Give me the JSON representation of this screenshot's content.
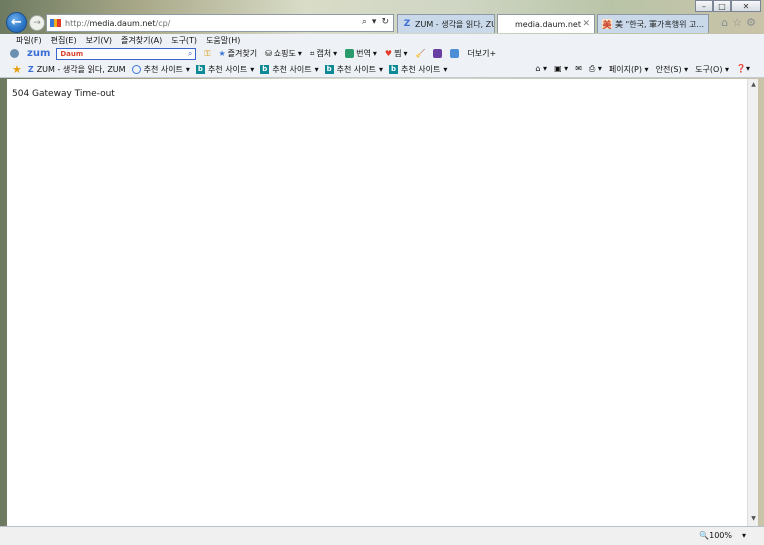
{
  "colors": {
    "accent": "#2f78c9",
    "favicon_blue": "#3a78d8",
    "favicon_yellow": "#f2b01e",
    "favicon_red": "#e23b2c",
    "zum_blue": "#3b6fd6",
    "daum_red": "#d8442f"
  },
  "window": {
    "controls": [
      "–",
      "□",
      "✕"
    ]
  },
  "nav": {
    "back_icon": "back-arrow-icon",
    "forward_icon": "forward-arrow-icon",
    "url_prefix": "http://",
    "url_domain": "media.daum.net",
    "url_path": "/cp/",
    "search_icon": "⌕",
    "dropdown_icon": "▾",
    "refresh_icon": "↻"
  },
  "tabs": [
    {
      "label": "ZUM - 생각을 읽다, ZU...",
      "icon": "Z",
      "active": false
    },
    {
      "label": "media.daum.net",
      "icon": "",
      "active": true,
      "close": "✕"
    },
    {
      "label": "美 \"한국, 軍가혹행위 고...",
      "icon": "美",
      "active": false
    }
  ],
  "right_icons": [
    "⌂",
    "☆",
    "⚙"
  ],
  "menu": [
    "파일(F)",
    "편집(E)",
    "보기(V)",
    "즐겨찾기(A)",
    "도구(T)",
    "도움말(H)"
  ],
  "zumbar": {
    "logo": "zum",
    "search_brand": "Daum",
    "search_placeholder": "",
    "items": [
      {
        "label": "즐겨찾기"
      },
      {
        "label": "쇼핑도"
      },
      {
        "label": "캡처"
      },
      {
        "label": "번역"
      },
      {
        "label": "찜"
      },
      {
        "label": "더보기+"
      }
    ]
  },
  "favorites": {
    "items": [
      {
        "label": "ZUM - 생각을 읽다, ZUM"
      },
      {
        "label": "추천 사이트"
      },
      {
        "label": "추천 사이트"
      },
      {
        "label": "추천 사이트"
      },
      {
        "label": "추천 사이트"
      },
      {
        "label": "추천 사이트"
      }
    ],
    "tools": [
      "페이지(P) ▾",
      "안전(S) ▾",
      "도구(O) ▾",
      "❓▾"
    ]
  },
  "content": {
    "error_message": "504 Gateway Time-out"
  },
  "status": {
    "zoom": "100%",
    "zoom_dropdown": "▾"
  }
}
